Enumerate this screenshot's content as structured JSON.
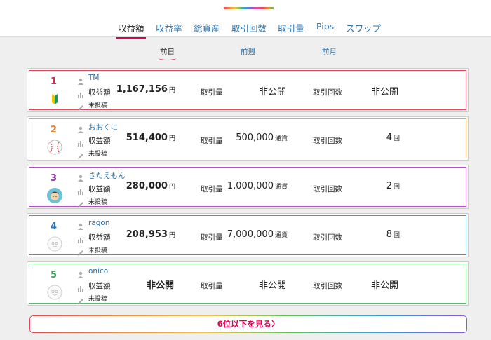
{
  "tabs": [
    {
      "label": "収益額",
      "active": true
    },
    {
      "label": "収益率",
      "active": false
    },
    {
      "label": "総資産",
      "active": false
    },
    {
      "label": "取引回数",
      "active": false
    },
    {
      "label": "取引量",
      "active": false
    },
    {
      "label": "Pips",
      "active": false
    },
    {
      "label": "スワップ",
      "active": false
    }
  ],
  "periods": [
    {
      "label": "前日",
      "active": true
    },
    {
      "label": "前週",
      "active": false
    },
    {
      "label": "前月",
      "active": false
    }
  ],
  "labels": {
    "profit": "収益額",
    "volume": "取引量",
    "count": "取引回数",
    "post_status": "未投稿",
    "yen_unit": "円",
    "currency_unit": "通貨",
    "count_unit": "回"
  },
  "rankings": [
    {
      "rank": "1",
      "rank_color": "#e0284f",
      "border_color": "#e8445a",
      "name": "TM",
      "avatar": "beginner-mark-icon",
      "profit": "1,167,156",
      "profit_unit": "円",
      "volume": "非公開",
      "volume_unit": "",
      "count": "非公開",
      "count_unit": ""
    },
    {
      "rank": "2",
      "rank_color": "#ef7d2b",
      "border_color": "#f0a35e",
      "name": "おおくに",
      "avatar": "baseball-icon",
      "profit": "514,400",
      "profit_unit": "円",
      "volume": "500,000",
      "volume_unit": "通貨",
      "count": "4",
      "count_unit": "回"
    },
    {
      "rank": "3",
      "rank_color": "#9b2fae",
      "border_color": "#b14fc8",
      "name": "きたえもん",
      "avatar": "face-avatar-icon",
      "profit": "280,000",
      "profit_unit": "円",
      "volume": "1,000,000",
      "volume_unit": "通貨",
      "count": "2",
      "count_unit": "回"
    },
    {
      "rank": "4",
      "rank_color": "#2a73c2",
      "border_color": "#4d8fd6",
      "name": "ragon",
      "avatar": "default-avatar-icon",
      "profit": "208,953",
      "profit_unit": "円",
      "volume": "7,000,000",
      "volume_unit": "通貨",
      "count": "8",
      "count_unit": "回"
    },
    {
      "rank": "5",
      "rank_color": "#3ba55c",
      "border_color": "#5cb870",
      "name": "onico",
      "avatar": "default-avatar-icon",
      "profit": "非公開",
      "profit_unit": "",
      "volume": "非公開",
      "volume_unit": "",
      "count": "非公開",
      "count_unit": ""
    }
  ],
  "more_button": "6位以下を見る〉"
}
